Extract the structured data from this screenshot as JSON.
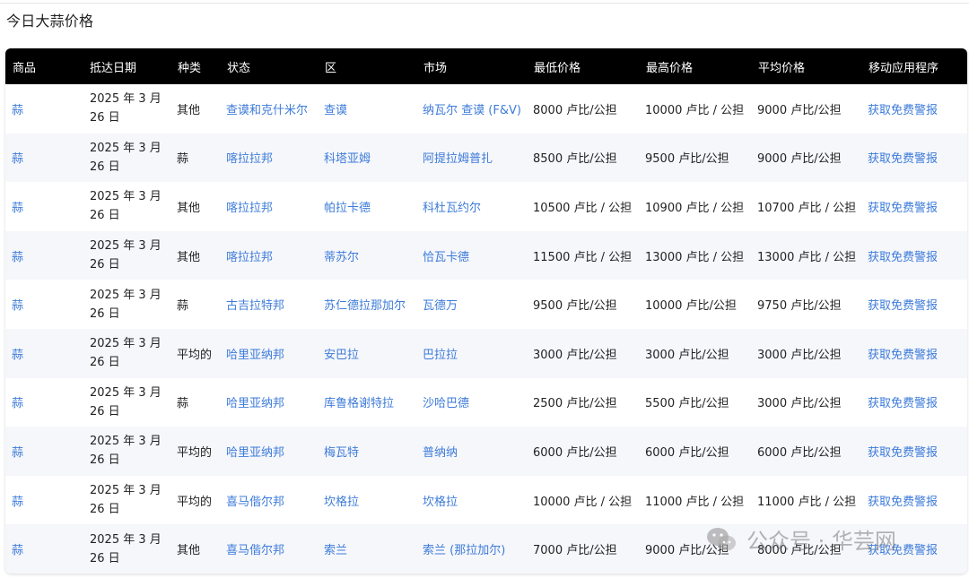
{
  "page": {
    "title": "今日大蒜价格"
  },
  "table": {
    "headers": [
      "商品",
      "抵达日期",
      "种类",
      "状态",
      "区",
      "市场",
      "最低价格",
      "最高价格",
      "平均价格",
      "移动应用程序"
    ],
    "rows": [
      {
        "commodity": "蒜",
        "date": "2025 年 3 月 26 日",
        "variety": "其他",
        "state": "查谟和克什米尔",
        "district": "查谟",
        "market": "纳瓦尔 查谟 (F&V)",
        "min": "8000 卢比/公担",
        "max": "10000 卢比 / 公担",
        "avg": "9000 卢比/公担",
        "app": "获取免费警报"
      },
      {
        "commodity": "蒜",
        "date": "2025 年 3 月 26 日",
        "variety": "蒜",
        "state": "喀拉拉邦",
        "district": "科塔亚姆",
        "market": "阿提拉姆普扎",
        "min": "8500 卢比/公担",
        "max": "9500 卢比/公担",
        "avg": "9000 卢比/公担",
        "app": "获取免费警报"
      },
      {
        "commodity": "蒜",
        "date": "2025 年 3 月 26 日",
        "variety": "其他",
        "state": "喀拉拉邦",
        "district": "帕拉卡德",
        "market": "科杜瓦约尔",
        "min": "10500 卢比 / 公担",
        "max": "10900 卢比 / 公担",
        "avg": "10700 卢比 / 公担",
        "app": "获取免费警报"
      },
      {
        "commodity": "蒜",
        "date": "2025 年 3 月 26 日",
        "variety": "其他",
        "state": "喀拉拉邦",
        "district": "蒂苏尔",
        "market": "恰瓦卡德",
        "min": "11500 卢比 / 公担",
        "max": "13000 卢比 / 公担",
        "avg": "13000 卢比 / 公担",
        "app": "获取免费警报"
      },
      {
        "commodity": "蒜",
        "date": "2025 年 3 月 26 日",
        "variety": "蒜",
        "state": "古吉拉特邦",
        "district": "苏仁德拉那加尔",
        "market": "瓦德万",
        "min": "9500 卢比/公担",
        "max": "10000 卢比/公担",
        "avg": "9750 卢比/公担",
        "app": "获取免费警报"
      },
      {
        "commodity": "蒜",
        "date": "2025 年 3 月 26 日",
        "variety": "平均的",
        "state": "哈里亚纳邦",
        "district": "安巴拉",
        "market": "巴拉拉",
        "min": "3000 卢比/公担",
        "max": "3000 卢比/公担",
        "avg": "3000 卢比/公担",
        "app": "获取免费警报"
      },
      {
        "commodity": "蒜",
        "date": "2025 年 3 月 26 日",
        "variety": "蒜",
        "state": "哈里亚纳邦",
        "district": "库鲁格谢特拉",
        "market": "沙哈巴德",
        "min": "2500 卢比/公担",
        "max": "5500 卢比/公担",
        "avg": "3000 卢比/公担",
        "app": "获取免费警报"
      },
      {
        "commodity": "蒜",
        "date": "2025 年 3 月 26 日",
        "variety": "平均的",
        "state": "哈里亚纳邦",
        "district": "梅瓦特",
        "market": "普纳纳",
        "min": "6000 卢比/公担",
        "max": "6000 卢比/公担",
        "avg": "6000 卢比/公担",
        "app": "获取免费警报"
      },
      {
        "commodity": "蒜",
        "date": "2025 年 3 月 26 日",
        "variety": "平均的",
        "state": "喜马偕尔邦",
        "district": "坎格拉",
        "market": "坎格拉",
        "min": "10000 卢比 / 公担",
        "max": "11000 卢比 / 公担",
        "avg": "11000 卢比 / 公担",
        "app": "获取免费警报"
      },
      {
        "commodity": "蒜",
        "date": "2025 年 3 月 26 日",
        "variety": "其他",
        "state": "喜马偕尔邦",
        "district": "索兰",
        "market": "索兰 (那拉加尔)",
        "min": "7000 卢比/公担",
        "max": "9000 卢比/公担",
        "avg": "8000 卢比/公担",
        "app": "获取免费警报"
      }
    ]
  },
  "watermark": {
    "text": "公众号 · 华芸网",
    "icon": "wechat-icon"
  }
}
